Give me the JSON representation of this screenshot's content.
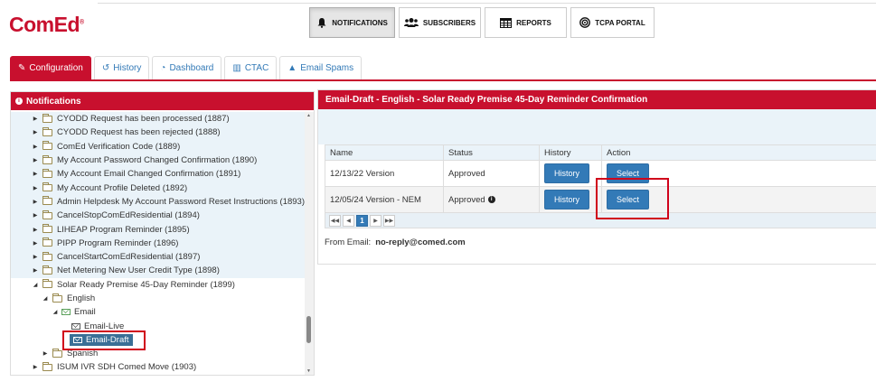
{
  "brand": {
    "logo_text": "ComEd",
    "logo_mark": "®",
    "color": "#c8102e"
  },
  "topnav": [
    {
      "label": "NOTIFICATIONS",
      "icon": "bell-icon",
      "active": true
    },
    {
      "label": "SUBSCRIBERS",
      "icon": "users-icon",
      "active": false
    },
    {
      "label": "REPORTS",
      "icon": "table-icon",
      "active": false
    },
    {
      "label": "TCPA PORTAL",
      "icon": "target-icon",
      "active": false
    }
  ],
  "tabs": [
    {
      "label": "Configuration",
      "icon": "edit-icon",
      "active": true
    },
    {
      "label": "History",
      "icon": "history-icon",
      "active": false
    },
    {
      "label": "Dashboard",
      "icon": "dashboard-icon",
      "active": false
    },
    {
      "label": "CTAC",
      "icon": "bar-chart-icon",
      "active": false
    },
    {
      "label": "Email Spams",
      "icon": "warning-icon",
      "active": false
    }
  ],
  "left_panel": {
    "title": "Notifications",
    "tree": [
      {
        "label": "CYODD Request has been processed (1887)",
        "depth": 0,
        "arrow": "▶",
        "type": "folder"
      },
      {
        "label": "CYODD Request has been rejected (1888)",
        "depth": 0,
        "arrow": "▶",
        "type": "folder"
      },
      {
        "label": "ComEd Verification Code (1889)",
        "depth": 0,
        "arrow": "▶",
        "type": "folder"
      },
      {
        "label": "My Account Password Changed Confirmation (1890)",
        "depth": 0,
        "arrow": "▶",
        "type": "folder"
      },
      {
        "label": "My Account Email Changed Confirmation (1891)",
        "depth": 0,
        "arrow": "▶",
        "type": "folder"
      },
      {
        "label": "My Account Profile Deleted (1892)",
        "depth": 0,
        "arrow": "▶",
        "type": "folder"
      },
      {
        "label": "Admin Helpdesk My Account Password Reset Instructions (1893)",
        "depth": 0,
        "arrow": "▶",
        "type": "folder"
      },
      {
        "label": "CancelStopComEdResidential (1894)",
        "depth": 0,
        "arrow": "▶",
        "type": "folder"
      },
      {
        "label": "LIHEAP Program Reminder (1895)",
        "depth": 0,
        "arrow": "▶",
        "type": "folder"
      },
      {
        "label": "PIPP Program Reminder (1896)",
        "depth": 0,
        "arrow": "▶",
        "type": "folder"
      },
      {
        "label": "CancelStartComEdResidential (1897)",
        "depth": 0,
        "arrow": "▶",
        "type": "folder"
      },
      {
        "label": "Net Metering New User Credit Type (1898)",
        "depth": 0,
        "arrow": "▶",
        "type": "folder"
      },
      {
        "label": "Solar Ready Premise 45-Day Reminder (1899)",
        "depth": 0,
        "arrow": "◢",
        "type": "folder"
      },
      {
        "label": "English",
        "depth": 1,
        "arrow": "◢",
        "type": "folder"
      },
      {
        "label": "Email",
        "depth": 2,
        "arrow": "◢",
        "type": "folder-green"
      },
      {
        "label": "Email-Live",
        "depth": 3,
        "arrow": "",
        "type": "envelope"
      },
      {
        "label": "Email-Draft",
        "depth": 3,
        "arrow": "",
        "type": "envelope-selected"
      },
      {
        "label": "Spanish",
        "depth": 1,
        "arrow": "▶",
        "type": "folder"
      },
      {
        "label": "ISUM IVR SDH Comed Move (1903)",
        "depth": 0,
        "arrow": "▶",
        "type": "folder"
      }
    ]
  },
  "right_panel": {
    "title": "Email-Draft - English - Solar Ready Premise 45-Day Reminder Confirmation",
    "columns": [
      "Name",
      "Status",
      "History",
      "Action"
    ],
    "rows": [
      {
        "name": "12/13/22 Version",
        "status": "Approved",
        "info": false,
        "history_label": "History",
        "action_label": "Select"
      },
      {
        "name": "12/05/24 Version - NEM",
        "status": "Approved",
        "info": true,
        "history_label": "History",
        "action_label": "Select"
      }
    ],
    "pager": {
      "first": "◀◀",
      "prev": "◀",
      "current": "1",
      "next": "▶",
      "last": "▶▶"
    },
    "from_label": "From Email:",
    "from_value": "no-reply@comed.com"
  }
}
